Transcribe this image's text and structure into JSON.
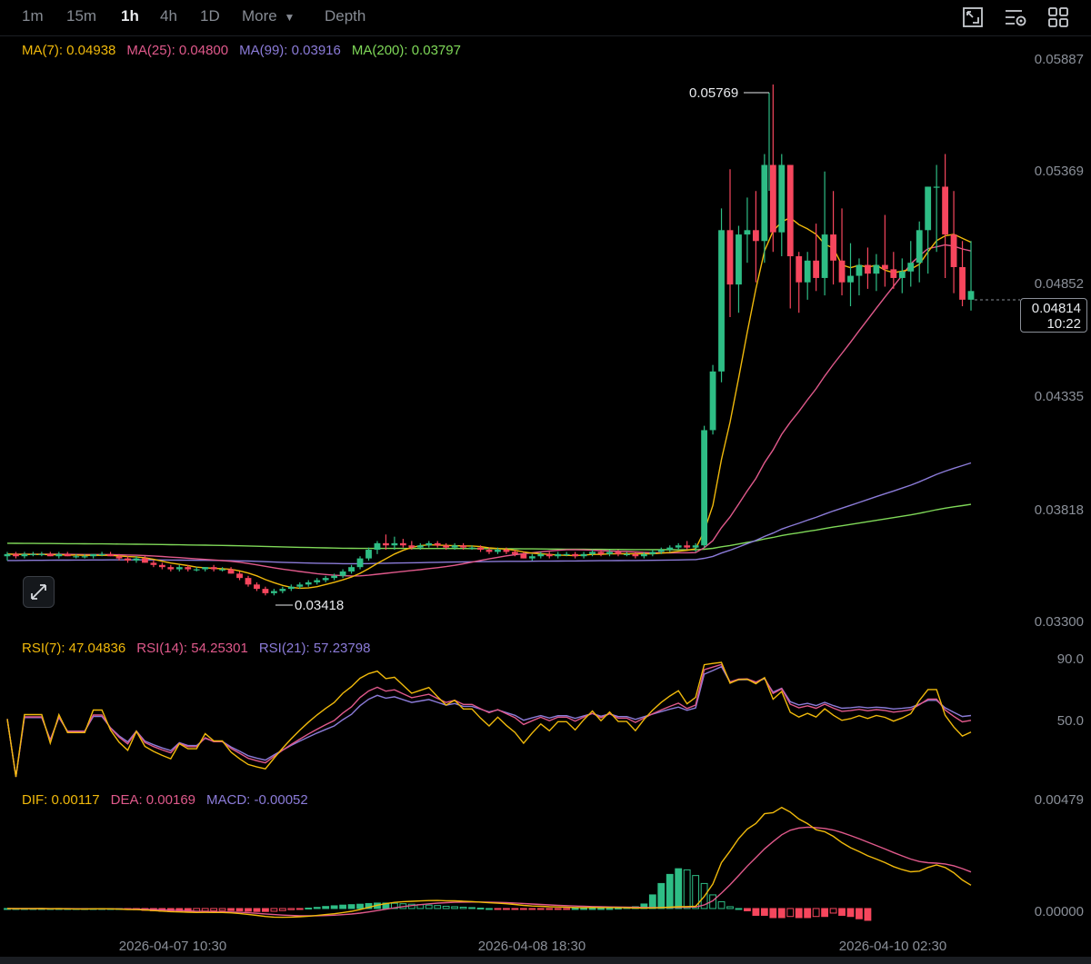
{
  "toolbar": {
    "timeframes": [
      "1m",
      "15m",
      "1h",
      "4h",
      "1D"
    ],
    "active_timeframe": "1h",
    "more_label": "More",
    "depth_label": "Depth",
    "icons": [
      "chart-settings-icon",
      "indicator-settings-icon",
      "layout-grid-icon"
    ]
  },
  "main_legend": {
    "ma7": "MA(7): 0.04938",
    "ma25": "MA(25): 0.04800",
    "ma99": "MA(99): 0.03916",
    "ma200": "MA(200): 0.03797"
  },
  "rsi_legend": {
    "rsi7": "RSI(7): 47.04836",
    "rsi14": "RSI(14): 54.25301",
    "rsi21": "RSI(21): 57.23798"
  },
  "macd_legend": {
    "dif": "DIF: 0.00117",
    "dea": "DEA: 0.00169",
    "macd": "MACD: -0.00052"
  },
  "price_axis": [
    "0.05887",
    "0.05369",
    "0.04852",
    "0.04335",
    "0.03818",
    "0.03300"
  ],
  "rsi_axis": [
    "90.0",
    "50.0"
  ],
  "macd_axis": [
    "0.00479",
    "0.00000"
  ],
  "time_axis": [
    "2026-04-07 10:30",
    "2026-04-08 18:30",
    "2026-04-10 02:30"
  ],
  "current_price": "0.04814",
  "countdown": "10:22",
  "high_marker": "0.05769",
  "low_marker": "0.03418",
  "colors": {
    "up": "#2ebd85",
    "down": "#f6465d",
    "ma7": "#f0b90b",
    "ma25": "#e0598b",
    "ma99": "#8b7bd8",
    "ma200": "#7fd858",
    "rsi7": "#f0b90b",
    "rsi14": "#e0598b",
    "rsi21": "#8b7bd8",
    "dif": "#f0b90b",
    "dea": "#e0598b",
    "macd": "#8b7bd8"
  },
  "chart_data": {
    "type": "candlestick",
    "interval": "1h",
    "price_range": [
      0.033,
      0.05887
    ],
    "candles": [
      [
        0.036,
        0.0362,
        0.0358,
        0.0361
      ],
      [
        0.0361,
        0.0362,
        0.0359,
        0.036
      ],
      [
        0.036,
        0.0362,
        0.0359,
        0.0361
      ],
      [
        0.0361,
        0.0362,
        0.036,
        0.0361
      ],
      [
        0.0361,
        0.0362,
        0.036,
        0.0361
      ],
      [
        0.0361,
        0.0362,
        0.036,
        0.036
      ],
      [
        0.036,
        0.0362,
        0.0359,
        0.0361
      ],
      [
        0.0361,
        0.0362,
        0.036,
        0.036
      ],
      [
        0.036,
        0.0361,
        0.0359,
        0.036
      ],
      [
        0.036,
        0.0361,
        0.0359,
        0.036
      ],
      [
        0.036,
        0.0361,
        0.0359,
        0.0361
      ],
      [
        0.0361,
        0.0362,
        0.036,
        0.0361
      ],
      [
        0.0361,
        0.0362,
        0.036,
        0.036
      ],
      [
        0.036,
        0.0361,
        0.0358,
        0.0359
      ],
      [
        0.0359,
        0.036,
        0.0357,
        0.0358
      ],
      [
        0.0358,
        0.036,
        0.0357,
        0.0359
      ],
      [
        0.0359,
        0.036,
        0.0357,
        0.0357
      ],
      [
        0.0357,
        0.0358,
        0.0355,
        0.0356
      ],
      [
        0.0356,
        0.0357,
        0.0354,
        0.0355
      ],
      [
        0.0355,
        0.0356,
        0.0353,
        0.0354
      ],
      [
        0.0354,
        0.0356,
        0.0353,
        0.0355
      ],
      [
        0.0355,
        0.0356,
        0.0353,
        0.0354
      ],
      [
        0.0354,
        0.0355,
        0.0353,
        0.0354
      ],
      [
        0.0354,
        0.0355,
        0.0353,
        0.0355
      ],
      [
        0.0355,
        0.0356,
        0.0353,
        0.0354
      ],
      [
        0.0354,
        0.0355,
        0.0353,
        0.0354
      ],
      [
        0.0354,
        0.0355,
        0.0352,
        0.0352
      ],
      [
        0.0352,
        0.0353,
        0.0349,
        0.035
      ],
      [
        0.035,
        0.0351,
        0.0346,
        0.0347
      ],
      [
        0.0347,
        0.0348,
        0.0344,
        0.0345
      ],
      [
        0.0345,
        0.0346,
        0.0342,
        0.0343
      ],
      [
        0.0343,
        0.0345,
        0.0342,
        0.0344
      ],
      [
        0.0344,
        0.0346,
        0.0343,
        0.0345
      ],
      [
        0.0345,
        0.0347,
        0.0344,
        0.0346
      ],
      [
        0.0346,
        0.0348,
        0.0345,
        0.0347
      ],
      [
        0.0347,
        0.0349,
        0.0346,
        0.0348
      ],
      [
        0.0348,
        0.035,
        0.0347,
        0.0349
      ],
      [
        0.0349,
        0.0351,
        0.0348,
        0.035
      ],
      [
        0.035,
        0.0352,
        0.0349,
        0.0351
      ],
      [
        0.0351,
        0.0354,
        0.035,
        0.0353
      ],
      [
        0.0353,
        0.0356,
        0.0352,
        0.0355
      ],
      [
        0.0355,
        0.036,
        0.0354,
        0.0359
      ],
      [
        0.0359,
        0.0364,
        0.0358,
        0.0363
      ],
      [
        0.0363,
        0.0367,
        0.0361,
        0.0366
      ],
      [
        0.0366,
        0.037,
        0.0363,
        0.0365
      ],
      [
        0.0365,
        0.0369,
        0.0363,
        0.0366
      ],
      [
        0.0366,
        0.0368,
        0.0364,
        0.0365
      ],
      [
        0.0365,
        0.0367,
        0.0363,
        0.0364
      ],
      [
        0.0364,
        0.0366,
        0.0363,
        0.0365
      ],
      [
        0.0365,
        0.0367,
        0.0364,
        0.0366
      ],
      [
        0.0366,
        0.0367,
        0.0364,
        0.0365
      ],
      [
        0.0365,
        0.0366,
        0.0363,
        0.0364
      ],
      [
        0.0364,
        0.0366,
        0.0363,
        0.0365
      ],
      [
        0.0365,
        0.0366,
        0.0363,
        0.0364
      ],
      [
        0.0364,
        0.0365,
        0.0363,
        0.0364
      ],
      [
        0.0364,
        0.0365,
        0.0362,
        0.0363
      ],
      [
        0.0363,
        0.0364,
        0.0361,
        0.0362
      ],
      [
        0.0362,
        0.0364,
        0.0361,
        0.0363
      ],
      [
        0.0363,
        0.0364,
        0.0361,
        0.0362
      ],
      [
        0.0362,
        0.0363,
        0.036,
        0.0361
      ],
      [
        0.0361,
        0.0362,
        0.0359,
        0.0359
      ],
      [
        0.0359,
        0.0361,
        0.0358,
        0.036
      ],
      [
        0.036,
        0.0362,
        0.0359,
        0.0361
      ],
      [
        0.0361,
        0.0362,
        0.0359,
        0.036
      ],
      [
        0.036,
        0.0362,
        0.0359,
        0.0361
      ],
      [
        0.0361,
        0.0362,
        0.036,
        0.0361
      ],
      [
        0.0361,
        0.0362,
        0.0359,
        0.036
      ],
      [
        0.036,
        0.0362,
        0.0359,
        0.0361
      ],
      [
        0.0361,
        0.0363,
        0.036,
        0.0362
      ],
      [
        0.0362,
        0.0363,
        0.036,
        0.0361
      ],
      [
        0.0361,
        0.0363,
        0.036,
        0.0362
      ],
      [
        0.0362,
        0.0363,
        0.036,
        0.0361
      ],
      [
        0.0361,
        0.0362,
        0.036,
        0.0361
      ],
      [
        0.0361,
        0.0362,
        0.0359,
        0.036
      ],
      [
        0.036,
        0.0362,
        0.0359,
        0.0361
      ],
      [
        0.0361,
        0.0363,
        0.036,
        0.0362
      ],
      [
        0.0362,
        0.0364,
        0.0361,
        0.0363
      ],
      [
        0.0363,
        0.0365,
        0.0362,
        0.0364
      ],
      [
        0.0364,
        0.0366,
        0.0363,
        0.0365
      ],
      [
        0.0365,
        0.0367,
        0.0363,
        0.0364
      ],
      [
        0.0364,
        0.0366,
        0.0362,
        0.0365
      ],
      [
        0.0365,
        0.042,
        0.0364,
        0.0418
      ],
      [
        0.0418,
        0.0448,
        0.0416,
        0.0445
      ],
      [
        0.0445,
        0.052,
        0.044,
        0.051
      ],
      [
        0.051,
        0.0538,
        0.047,
        0.0485
      ],
      [
        0.0485,
        0.0512,
        0.0472,
        0.0508
      ],
      [
        0.0508,
        0.0525,
        0.0495,
        0.051
      ],
      [
        0.051,
        0.0528,
        0.0486,
        0.0505
      ],
      [
        0.0505,
        0.0545,
        0.0495,
        0.054
      ],
      [
        0.054,
        0.0577,
        0.05,
        0.0509
      ],
      [
        0.0509,
        0.0545,
        0.0498,
        0.054
      ],
      [
        0.054,
        0.051,
        0.0474,
        0.0498
      ],
      [
        0.0498,
        0.05,
        0.0472,
        0.0486
      ],
      [
        0.0486,
        0.05,
        0.0478,
        0.0496
      ],
      [
        0.0496,
        0.0513,
        0.0482,
        0.0488
      ],
      [
        0.0488,
        0.0537,
        0.048,
        0.0508
      ],
      [
        0.0508,
        0.0528,
        0.0485,
        0.0496
      ],
      [
        0.0496,
        0.052,
        0.048,
        0.0486
      ],
      [
        0.0486,
        0.0504,
        0.0475,
        0.0489
      ],
      [
        0.0489,
        0.0497,
        0.048,
        0.0494
      ],
      [
        0.0494,
        0.0502,
        0.0483,
        0.049
      ],
      [
        0.049,
        0.0499,
        0.0482,
        0.0494
      ],
      [
        0.0494,
        0.0517,
        0.0484,
        0.0492
      ],
      [
        0.0492,
        0.05,
        0.0483,
        0.0488
      ],
      [
        0.0488,
        0.0497,
        0.0481,
        0.0491
      ],
      [
        0.0491,
        0.0505,
        0.0484,
        0.0495
      ],
      [
        0.0495,
        0.0514,
        0.0486,
        0.051
      ],
      [
        0.051,
        0.0525,
        0.049,
        0.053
      ],
      [
        0.053,
        0.054,
        0.05,
        0.053
      ],
      [
        0.053,
        0.0545,
        0.0488,
        0.0508
      ],
      [
        0.0508,
        0.0528,
        0.0481,
        0.0493
      ],
      [
        0.0493,
        0.0505,
        0.0475,
        0.0478
      ],
      [
        0.0478,
        0.0505,
        0.0473,
        0.0482
      ]
    ],
    "rsi_range": [
      0,
      100
    ],
    "macd_range": [
      -0.0012,
      0.00479
    ],
    "macd_hist": [
      0,
      0,
      0,
      0,
      0,
      0,
      0,
      0,
      0,
      0,
      0,
      0,
      0,
      0,
      -3e-05,
      -5e-05,
      -8e-05,
      -0.0001,
      -0.00012,
      -0.00013,
      -0.00013,
      -0.00013,
      -0.00012,
      -0.00011,
      -0.0001,
      -9e-05,
      -9e-05,
      -0.0001,
      -0.00012,
      -0.00013,
      -0.00013,
      -0.00012,
      -9e-05,
      -5e-05,
      -2e-05,
      2e-05,
      5e-05,
      9e-05,
      0.00012,
      0.00015,
      0.00017,
      0.00019,
      0.00022,
      0.00024,
      0.00024,
      0.00023,
      0.00021,
      0.00019,
      0.00017,
      0.00015,
      0.00013,
      0.0001,
      8e-05,
      6e-05,
      4e-05,
      2e-05,
      0,
      -1e-05,
      -2e-05,
      -3e-05,
      -3e-05,
      -3e-05,
      -2e-05,
      -2e-05,
      -1e-05,
      -1e-05,
      0,
      0,
      0,
      0,
      0,
      2e-05,
      4e-05,
      8e-05,
      0.0002,
      0.0006,
      0.0011,
      0.0015,
      0.00175,
      0.0017,
      0.00145,
      0.0011,
      0.0006,
      0.0003,
      8e-05,
      0,
      -0.0001,
      -0.0003,
      -0.0003,
      -0.0004,
      -0.0004,
      -0.00035,
      -0.0004,
      -0.0004,
      -0.00035,
      -0.00035,
      -0.0002,
      -0.0003,
      -0.00035,
      -0.00045,
      -0.00052
    ]
  }
}
